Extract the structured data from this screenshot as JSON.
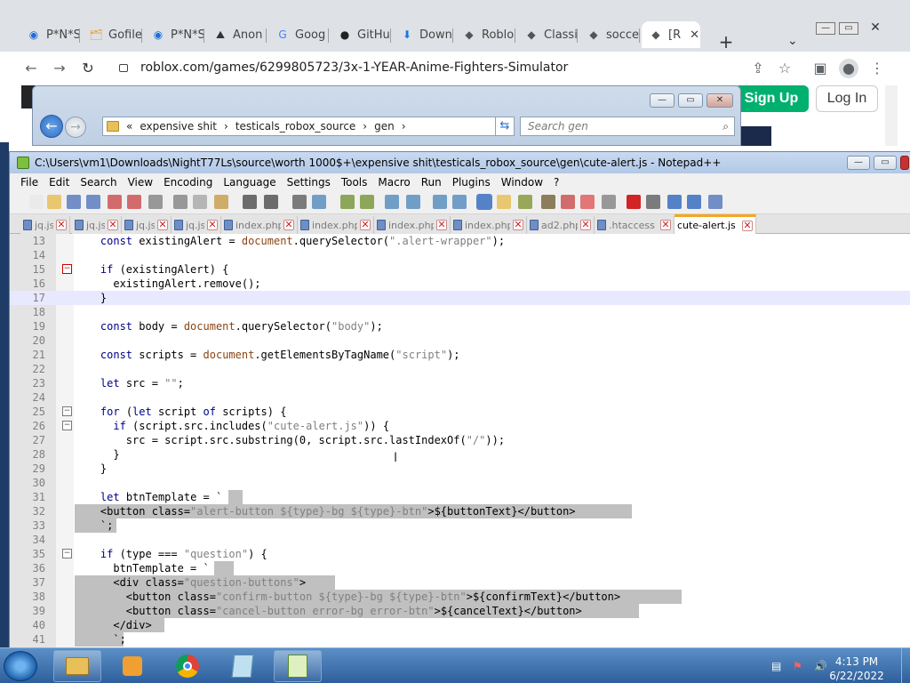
{
  "browser": {
    "tabs": [
      {
        "label": "P*N*S",
        "icon": "edge-icon"
      },
      {
        "label": "Gofile",
        "icon": "gofile-icon"
      },
      {
        "label": "P*N*S",
        "icon": "edge-icon"
      },
      {
        "label": "Anon",
        "icon": "anon-icon"
      },
      {
        "label": "Goog",
        "icon": "google-icon"
      },
      {
        "label": "GitHu",
        "icon": "github-icon"
      },
      {
        "label": "Down",
        "icon": "download-icon"
      },
      {
        "label": "Roblo",
        "icon": "roblox-icon"
      },
      {
        "label": "Classi",
        "icon": "roblox-icon"
      },
      {
        "label": "socce",
        "icon": "roblox-icon"
      },
      {
        "label": "[R",
        "icon": "roblox-icon",
        "active": true
      }
    ],
    "url": "roblox.com/games/6299805723/3x-1-YEAR-Anime-Fighters-Simulator",
    "page": {
      "signup_label": "Sign Up",
      "login_label": "Log In"
    }
  },
  "explorer": {
    "breadcrumb": [
      "«",
      "expensive shit",
      "testicals_robox_source",
      "gen"
    ],
    "search_placeholder": "Search gen"
  },
  "notepad": {
    "title": "C:\\Users\\vm1\\Downloads\\NightT77Ls\\source\\worth 1000$+\\expensive shit\\testicals_robox_source\\gen\\cute-alert.js - Notepad++",
    "menu": [
      "File",
      "Edit",
      "Search",
      "View",
      "Encoding",
      "Language",
      "Settings",
      "Tools",
      "Macro",
      "Run",
      "Plugins",
      "Window",
      "?"
    ],
    "doc_tabs": [
      {
        "label": "jq.js"
      },
      {
        "label": "jq.js"
      },
      {
        "label": "jq.js"
      },
      {
        "label": "jq.js"
      },
      {
        "label": "index.php"
      },
      {
        "label": "index.php"
      },
      {
        "label": "index.php"
      },
      {
        "label": "index.php"
      },
      {
        "label": "ad2.php"
      },
      {
        "label": ".htaccess"
      },
      {
        "label": "cute-alert.js",
        "active": true
      }
    ],
    "lines": [
      {
        "n": "13",
        "t": "    const existingAlert = document.querySelector(\".alert-wrapper\");"
      },
      {
        "n": "14",
        "t": ""
      },
      {
        "n": "15",
        "t": "    if (existingAlert) {"
      },
      {
        "n": "16",
        "t": "      existingAlert.remove();"
      },
      {
        "n": "17",
        "t": "    }"
      },
      {
        "n": "18",
        "t": ""
      },
      {
        "n": "19",
        "t": "    const body = document.querySelector(\"body\");"
      },
      {
        "n": "20",
        "t": ""
      },
      {
        "n": "21",
        "t": "    const scripts = document.getElementsByTagName(\"script\");"
      },
      {
        "n": "22",
        "t": ""
      },
      {
        "n": "23",
        "t": "    let src = \"\";"
      },
      {
        "n": "24",
        "t": ""
      },
      {
        "n": "25",
        "t": "    for (let script of scripts) {"
      },
      {
        "n": "26",
        "t": "      if (script.src.includes(\"cute-alert.js\")) {"
      },
      {
        "n": "27",
        "t": "        src = script.src.substring(0, script.src.lastIndexOf(\"/\"));"
      },
      {
        "n": "28",
        "t": "      }"
      },
      {
        "n": "29",
        "t": "    }"
      },
      {
        "n": "30",
        "t": ""
      },
      {
        "n": "31",
        "t": "    let btnTemplate = `"
      },
      {
        "n": "32",
        "t": "    <button class=\"alert-button ${type}-bg ${type}-btn\">${buttonText}</button>"
      },
      {
        "n": "33",
        "t": "    `;"
      },
      {
        "n": "34",
        "t": ""
      },
      {
        "n": "35",
        "t": "    if (type === \"question\") {"
      },
      {
        "n": "36",
        "t": "      btnTemplate = `"
      },
      {
        "n": "37",
        "t": "      <div class=\"question-buttons\">"
      },
      {
        "n": "38",
        "t": "        <button class=\"confirm-button ${type}-bg ${type}-btn\">${confirmText}</button>"
      },
      {
        "n": "39",
        "t": "        <button class=\"cancel-button error-bg error-btn\">${cancelText}</button>"
      },
      {
        "n": "40",
        "t": "      </div>"
      },
      {
        "n": "41",
        "t": "      `;"
      }
    ]
  },
  "taskbar": {
    "clock_time": "4:13 PM",
    "clock_date": "6/22/2022"
  },
  "colors": {
    "signup_green": "#00b06f",
    "selection": "#c0c0c0",
    "active_tab_accent": "#f5a623"
  }
}
